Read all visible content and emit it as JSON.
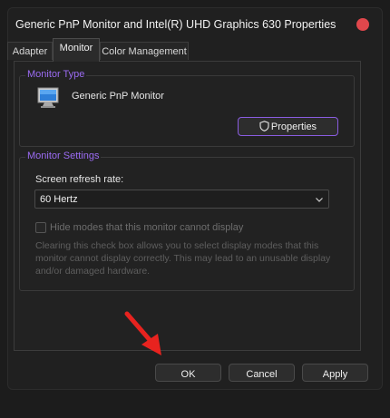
{
  "window": {
    "title": "Generic PnP Monitor and Intel(R) UHD Graphics 630 Properties"
  },
  "tabs": [
    {
      "label": "Adapter",
      "active": false
    },
    {
      "label": "Monitor",
      "active": true
    },
    {
      "label": "Color Management",
      "active": false
    }
  ],
  "monitor_type": {
    "legend": "Monitor Type",
    "monitor_name": "Generic PnP Monitor",
    "properties_label": "Properties",
    "icon": "monitor-icon"
  },
  "monitor_settings": {
    "legend": "Monitor Settings",
    "refresh_label": "Screen refresh rate:",
    "refresh_value": "60 Hertz",
    "hide_modes_label": "Hide modes that this monitor cannot display",
    "hide_modes_checked": false,
    "description": "Clearing this check box allows you to select display modes that this monitor cannot display correctly. This may lead to an unusable display and/or damaged hardware."
  },
  "buttons": {
    "ok": "OK",
    "cancel": "Cancel",
    "apply": "Apply"
  },
  "colors": {
    "accent": "#9b6bf2",
    "close": "#e0474c",
    "arrow": "#e8231f"
  }
}
